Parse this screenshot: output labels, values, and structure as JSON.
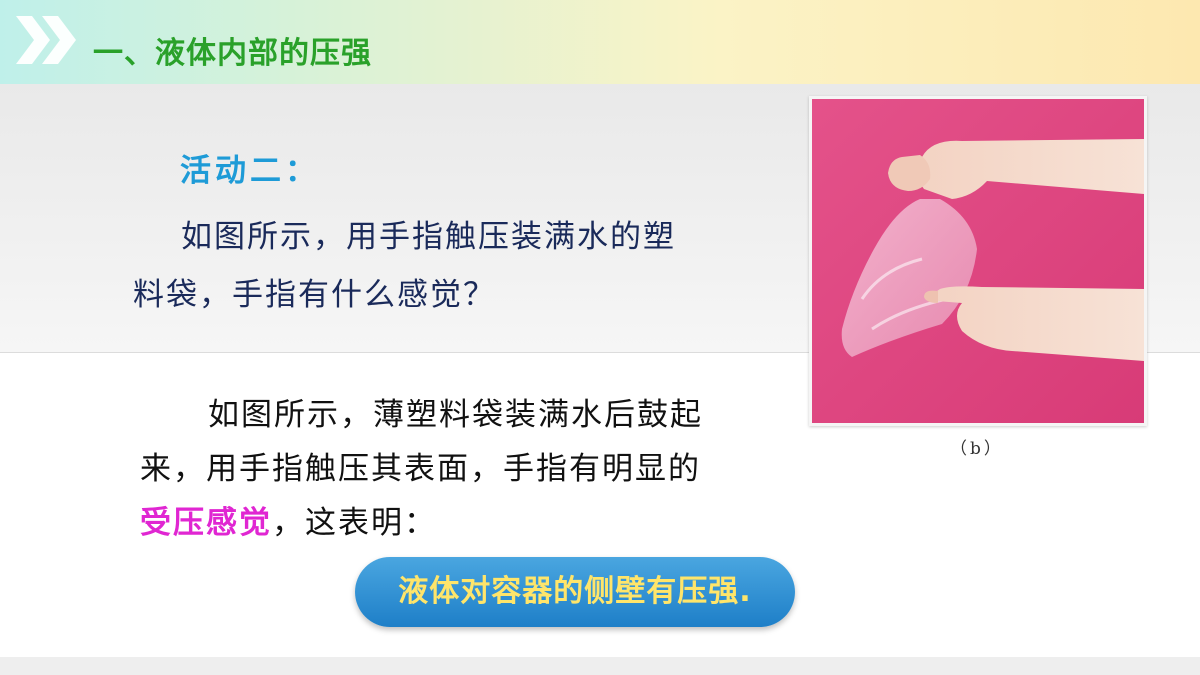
{
  "header": {
    "title": "一、液体内部的压强",
    "chevron_icon": "double-chevron-right-icon",
    "title_color": "#2aa12a"
  },
  "activity": {
    "label": "活动二："
  },
  "question": {
    "line1": "如图所示，用手指触压装满水的塑",
    "line2": "料袋，手指有什么感觉？"
  },
  "answer": {
    "line1": "如图所示，薄塑料袋装满水后鼓起",
    "line2": "来，用手指触压其表面，手指有明显的",
    "line3_highlight": "受压感觉",
    "line3_rest": "，这表明："
  },
  "conclusion": {
    "text": "液体对容器的侧壁有压强."
  },
  "figure": {
    "caption": "（b）",
    "background_color": "#e0457f"
  },
  "colors": {
    "accent_blue": "#1e9bd7",
    "highlight_pink": "#e026d2",
    "pill_blue": "#1e7fc8",
    "pill_text": "#ffe56a"
  }
}
